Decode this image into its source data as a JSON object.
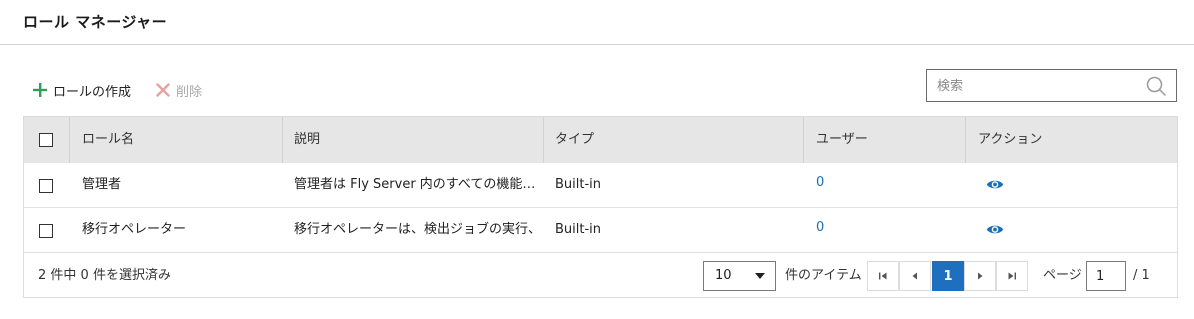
{
  "header": {
    "title": "ロール マネージャー"
  },
  "toolbar": {
    "create_label": "ロールの作成",
    "delete_label": "削除"
  },
  "search": {
    "placeholder": "検索"
  },
  "table": {
    "columns": [
      "ロール名",
      "説明",
      "タイプ",
      "ユーザー",
      "アクション"
    ],
    "rows": [
      {
        "name": "管理者",
        "description": "管理者は Fly Server 内のすべての機能…",
        "type": "Built-in",
        "users": "0"
      },
      {
        "name": "移行オペレーター",
        "description": "移行オペレーターは、検出ジョブの実行、…",
        "type": "Built-in",
        "users": "0"
      }
    ]
  },
  "footer": {
    "selection_text": "2 件中 0 件を選択済み",
    "page_size": "10",
    "items_label": "件のアイテム",
    "current_page": "1",
    "page_label": "ページ",
    "page_input": "1",
    "page_total": "/ 1"
  },
  "colors": {
    "accent": "#1f6fbf",
    "create_icon": "#2e9e5b",
    "delete_icon": "#e8a2a2",
    "link": "#1a6fb5"
  }
}
